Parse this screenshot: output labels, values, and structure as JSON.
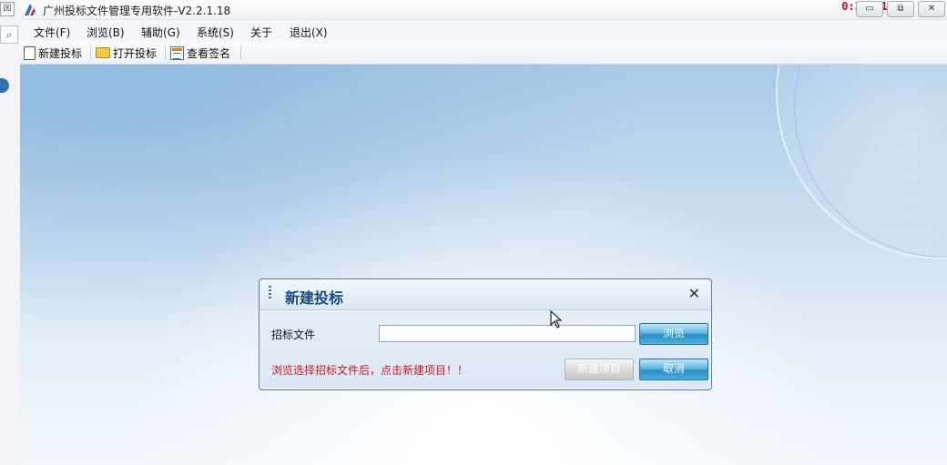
{
  "left_strip": {
    "close_glyph": "☒",
    "search_glyph": "⌕"
  },
  "titlebar": {
    "title": "广州投标文件管理专用软件-V2.2.1.18",
    "timer": "0:3/1:12",
    "buttons": {
      "minimize": "▭",
      "restore": "⧉",
      "close": "✕"
    }
  },
  "menu": {
    "items": [
      "文件(F)",
      "浏览(B)",
      "辅助(G)",
      "系统(S)",
      "关于",
      "退出(X)"
    ]
  },
  "toolbar": {
    "new_bid": "新建投标",
    "open_bid": "打开投标",
    "view_sign": "查看签名"
  },
  "dialog": {
    "title": "新建投标",
    "close_glyph": "✕",
    "file_label": "招标文件",
    "file_value": "",
    "browse": "浏览",
    "new_project": "新建项目",
    "cancel": "取消",
    "hint": "浏览选择招标文件后，点击新建项目！！"
  },
  "colors": {
    "accent": "#1b4a7a",
    "warning_text": "#d8141e",
    "timer": "#e0001a"
  }
}
